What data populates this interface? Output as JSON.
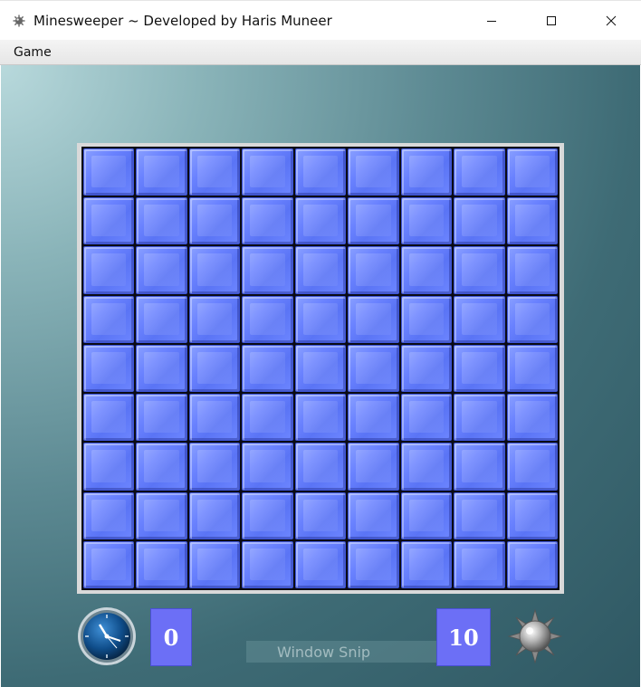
{
  "window": {
    "title": "Minesweeper ~ Developed by Haris Muneer",
    "icon": "mine-app-icon",
    "controls": [
      "minimize",
      "maximize",
      "close"
    ]
  },
  "menu": {
    "items": [
      {
        "label": "Game"
      }
    ]
  },
  "board": {
    "rows": 9,
    "cols": 9,
    "cell_state": "unrevealed",
    "cell_color": "#6a82ff"
  },
  "status": {
    "timer_icon": "clock-icon",
    "timer_value": "0",
    "mines_value": "10",
    "mines_icon": "mine-icon"
  },
  "overlay": {
    "watermark": "Window Snip"
  }
}
